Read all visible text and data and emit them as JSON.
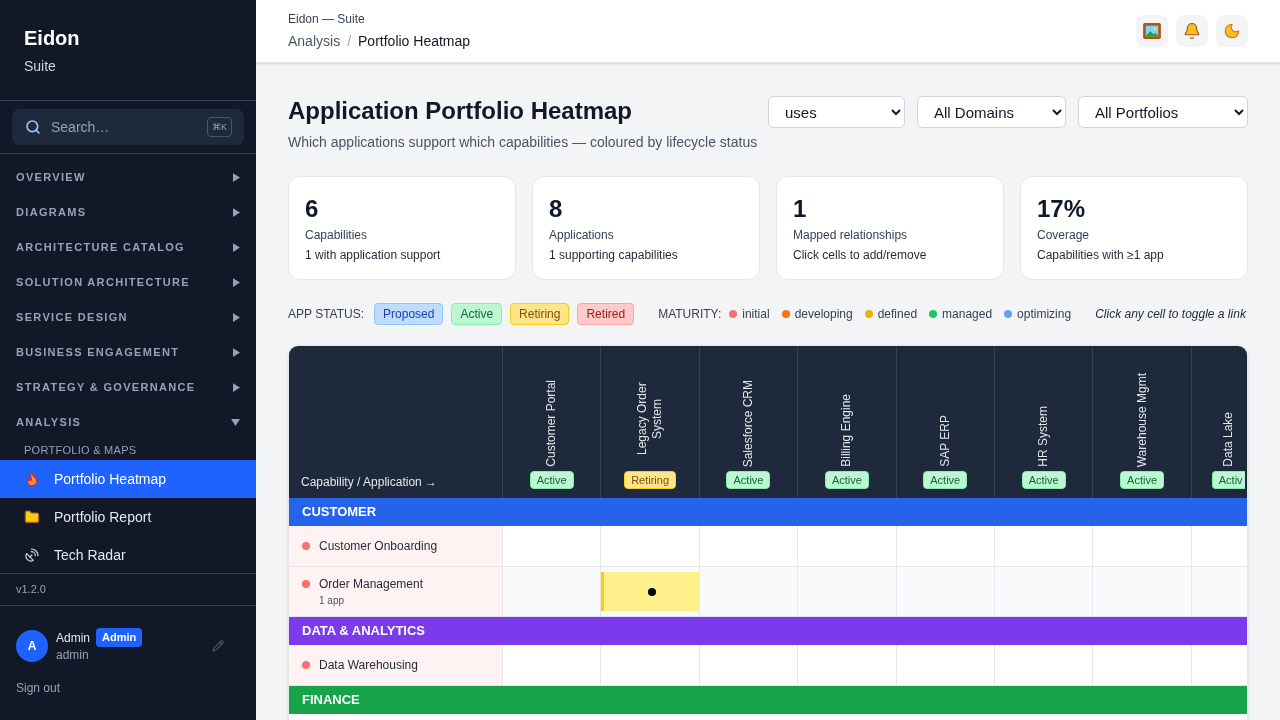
{
  "sidebar": {
    "brand": {
      "title": "Eidon",
      "subtitle": "Suite"
    },
    "search": {
      "label": "Search…",
      "shortcut": "⌘K"
    },
    "sections": [
      {
        "label": "OVERVIEW",
        "expanded": false
      },
      {
        "label": "DIAGRAMS",
        "expanded": false
      },
      {
        "label": "ARCHITECTURE CATALOG",
        "expanded": false
      },
      {
        "label": "SOLUTION ARCHITECTURE",
        "expanded": false
      },
      {
        "label": "SERVICE DESIGN",
        "expanded": false
      },
      {
        "label": "BUSINESS ENGAGEMENT",
        "expanded": false
      },
      {
        "label": "STRATEGY & GOVERNANCE",
        "expanded": false
      },
      {
        "label": "ANALYSIS",
        "expanded": true,
        "groups": [
          {
            "heading": "PORTFOLIO & MAPS",
            "items": [
              {
                "label": "Portfolio Heatmap",
                "selected": true
              },
              {
                "label": "Portfolio Report",
                "selected": false
              },
              {
                "label": "Tech Radar",
                "selected": false
              }
            ]
          }
        ]
      }
    ],
    "version": "v1.2.0",
    "user": {
      "initial": "A",
      "name": "Admin",
      "role_badge": "Admin",
      "username": "admin"
    },
    "sign_out": "Sign out"
  },
  "header": {
    "app_title": "Eidon — Suite",
    "breadcrumb": {
      "items": [
        {
          "label": "Analysis"
        },
        {
          "label": "Portfolio Heatmap"
        }
      ],
      "separator": "/"
    }
  },
  "page": {
    "title": "Application Portfolio Heatmap",
    "subtitle": "Which applications support which capabilities — coloured by lifecycle status",
    "filters": [
      {
        "value": "uses"
      },
      {
        "value": "All Domains"
      },
      {
        "value": "All Portfolios"
      }
    ]
  },
  "stats": [
    {
      "value": "6",
      "label": "Capabilities",
      "detail": "1 with application support"
    },
    {
      "value": "8",
      "label": "Applications",
      "detail": "1 supporting capabilities"
    },
    {
      "value": "1",
      "label": "Mapped relationships",
      "detail": "Click cells to add/remove"
    },
    {
      "value": "17%",
      "label": "Coverage",
      "detail": "Capabilities with ≥1 app"
    }
  ],
  "legend": {
    "status_label": "APP STATUS:",
    "statuses": [
      {
        "label": "Proposed",
        "kind": "proposed"
      },
      {
        "label": "Active",
        "kind": "active"
      },
      {
        "label": "Retiring",
        "kind": "retiring"
      },
      {
        "label": "Retired",
        "kind": "retired"
      }
    ],
    "maturity_label": "MATURITY:",
    "maturity": [
      {
        "label": "initial",
        "color": "#f87171"
      },
      {
        "label": "developing",
        "color": "#f97316"
      },
      {
        "label": "defined",
        "color": "#eab308"
      },
      {
        "label": "managed",
        "color": "#22c55e"
      },
      {
        "label": "optimizing",
        "color": "#60a5fa"
      }
    ],
    "hint": "Click any cell to toggle a link"
  },
  "heatmap": {
    "corner": "Capability / Application →",
    "applications": [
      {
        "name": "Customer Portal",
        "kind": "active",
        "badge": "Active"
      },
      {
        "name": "Legacy Order System",
        "kind": "retiring",
        "badge": "Retiring"
      },
      {
        "name": "Salesforce CRM",
        "kind": "active",
        "badge": "Active"
      },
      {
        "name": "Billing Engine",
        "kind": "active",
        "badge": "Active"
      },
      {
        "name": "SAP ERP",
        "kind": "active",
        "badge": "Active"
      },
      {
        "name": "HR System",
        "kind": "active",
        "badge": "Active"
      },
      {
        "name": "Warehouse Mgmt",
        "kind": "active",
        "badge": "Active"
      },
      {
        "name": "Data Lake",
        "kind": "active",
        "badge": "Activ"
      }
    ],
    "groups": [
      {
        "name": "CUSTOMER",
        "color": "#2563eb",
        "capabilities": [
          {
            "name": "Customer Onboarding",
            "color": "#f87171",
            "links": [
              false,
              false,
              false,
              false,
              false,
              false,
              false,
              false
            ]
          },
          {
            "name": "Order Management",
            "sub": "1 app",
            "color": "#f87171",
            "links": [
              false,
              true,
              false,
              false,
              false,
              false,
              false,
              false
            ]
          }
        ]
      },
      {
        "name": "DATA & ANALYTICS",
        "color": "#7c3aed",
        "capabilities": [
          {
            "name": "Data Warehousing",
            "color": "#f87171",
            "links": [
              false,
              false,
              false,
              false,
              false,
              false,
              false,
              false
            ]
          }
        ]
      },
      {
        "name": "FINANCE",
        "color": "#16a34a"
      }
    ]
  }
}
